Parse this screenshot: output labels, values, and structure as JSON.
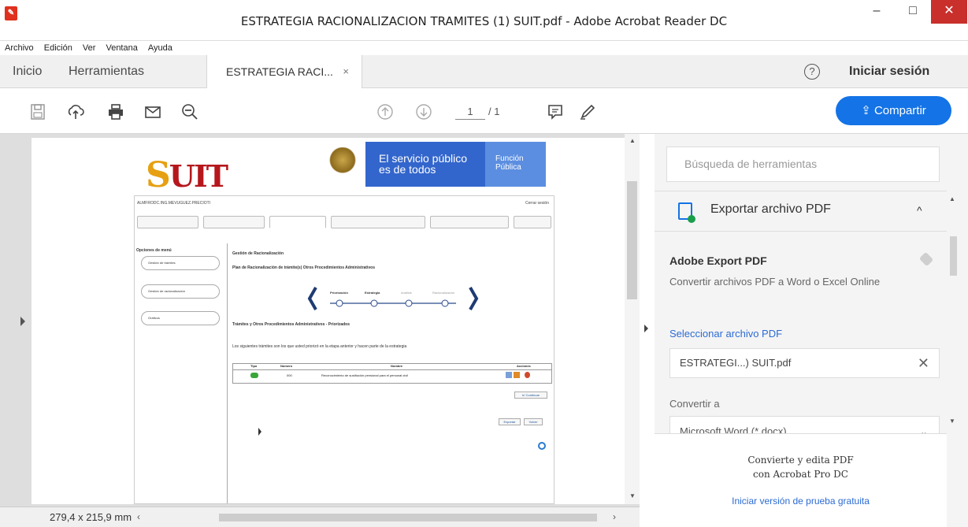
{
  "window": {
    "title": "ESTRATEGIA RACIONALIZACION TRAMITES (1) SUIT.pdf - Adobe Acrobat Reader DC",
    "minimize": "–",
    "maximize": "□",
    "close": "✕"
  },
  "menu": [
    "Archivo",
    "Edición",
    "Ver",
    "Ventana",
    "Ayuda"
  ],
  "tabs": {
    "home": "Inicio",
    "tools": "Herramientas",
    "doc": "ESTRATEGIA RACI...",
    "doc_close": "×",
    "signin": "Iniciar sesión",
    "help": "?"
  },
  "toolbar": {
    "share": "Compartir",
    "page_current": "1",
    "page_total": "/ 1",
    "icons": [
      "save-icon",
      "upload-icon",
      "print-icon",
      "mail-icon",
      "zoom-out-icon",
      "page-up-icon",
      "page-down-icon",
      "comment-icon",
      "pen-icon"
    ]
  },
  "document": {
    "banner_line1": "El servicio público",
    "banner_line2": "es de todos",
    "banner_brand1": "Función",
    "banner_brand2": "Pública",
    "logo_rest": "UIT",
    "logo_first": "S",
    "inner_title": "ALMFRODC.ING.MEVUGUEZ.PRECIOTI",
    "inner_right": "Cerrar sesión",
    "side_title": "Opciones de menú",
    "side_buttons": [
      "Gestión de trámites",
      "Gestión de racionalización",
      "Gráficos"
    ],
    "heading1": "Gestión de Racionalización",
    "heading2": "Plan de Racionalización de trámite(s) Otros Procedimientos Administrativos",
    "steps": [
      "Priorización",
      "Estrategia",
      "Análisis",
      "Racionalización"
    ],
    "section_title": "Trámites y Otros Procedimientos Administrativos - Priorizados",
    "section_desc": "Los siguientes trámites son los que usted priorizó en la etapa anterior y hacen parte de la estrategia",
    "table_headers": [
      "Tipo",
      "Número",
      "Nombre",
      "Acciones"
    ],
    "table_row": {
      "number": "000",
      "name": "Reconocimiento de sustitución pensional para el personal civil"
    },
    "btn_continue": "Ir/ Continuar",
    "btn_export": "Exportar",
    "btn_other": "Volver"
  },
  "status": {
    "dims": "279,4 x 215,9 mm"
  },
  "right_panel": {
    "search_placeholder": "Búsqueda de herramientas",
    "export_title": "Exportar archivo PDF",
    "ae_title": "Adobe Export PDF",
    "ae_desc": "Convertir archivos PDF a Word o Excel Online",
    "select_link": "Seleccionar archivo PDF",
    "file_name": "ESTRATEGI...) SUIT.pdf",
    "convert_label": "Convertir a",
    "convert_value": "Microsoft Word (*.docx)",
    "promo_line1": "Convierte y edita PDF",
    "promo_line2": "con Acrobat Pro DC",
    "trial_link": "Iniciar versión de prueba gratuita"
  },
  "colors": {
    "accent": "#1473e6",
    "close_red": "#c9302c",
    "link": "#2c6bd2"
  }
}
